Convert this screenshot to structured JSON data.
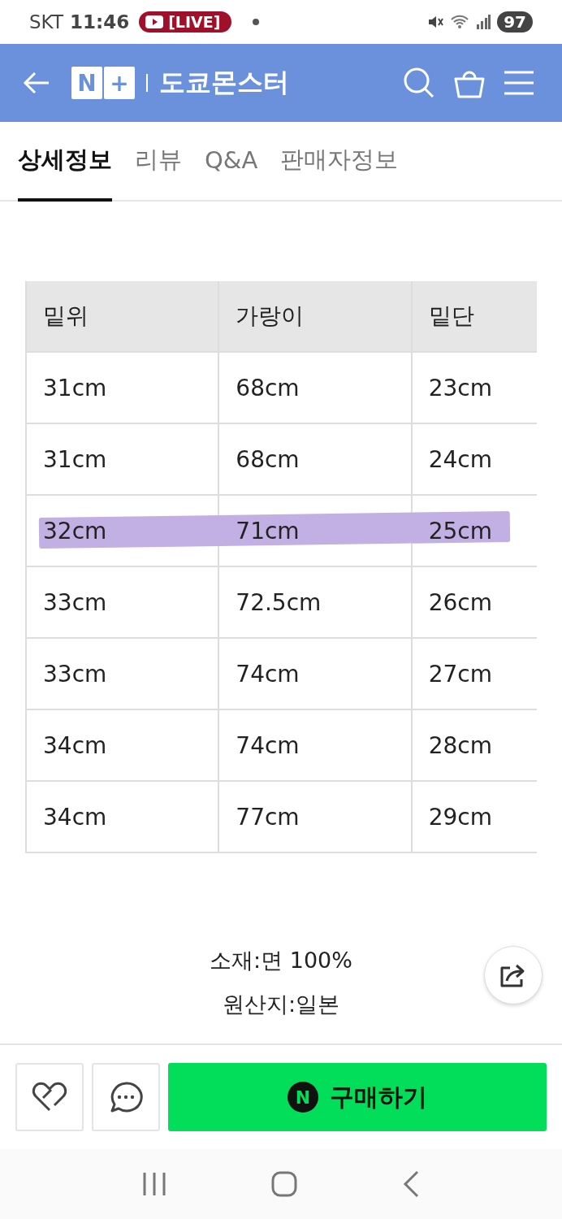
{
  "status_bar": {
    "carrier": "SKT",
    "time": "11:46",
    "live_badge": "[LIVE]",
    "battery": "97"
  },
  "header": {
    "logo_letter": "N",
    "logo_plus": "+",
    "store_name": "도쿄몬스터"
  },
  "tabs": [
    {
      "label": "상세정보",
      "selected": true
    },
    {
      "label": "리뷰",
      "selected": false
    },
    {
      "label": "Q&A",
      "selected": false
    },
    {
      "label": "판매자정보",
      "selected": false
    }
  ],
  "table": {
    "columns": [
      "밑위",
      "가랑이",
      "밑단"
    ],
    "rows": [
      {
        "cells": [
          "31cm",
          "68cm",
          "23cm"
        ],
        "highlighted": false
      },
      {
        "cells": [
          "31cm",
          "68cm",
          "24cm"
        ],
        "highlighted": false
      },
      {
        "cells": [
          "32cm",
          "71cm",
          "25cm"
        ],
        "highlighted": true
      },
      {
        "cells": [
          "33cm",
          "72.5cm",
          "26cm"
        ],
        "highlighted": false
      },
      {
        "cells": [
          "33cm",
          "74cm",
          "27cm"
        ],
        "highlighted": false
      },
      {
        "cells": [
          "34cm",
          "74cm",
          "28cm"
        ],
        "highlighted": false
      },
      {
        "cells": [
          "34cm",
          "77cm",
          "29cm"
        ],
        "highlighted": false
      }
    ]
  },
  "details": [
    "소재:면 100%",
    "원산지:일본"
  ],
  "buy_button": {
    "badge": "N",
    "label": "구매하기"
  }
}
